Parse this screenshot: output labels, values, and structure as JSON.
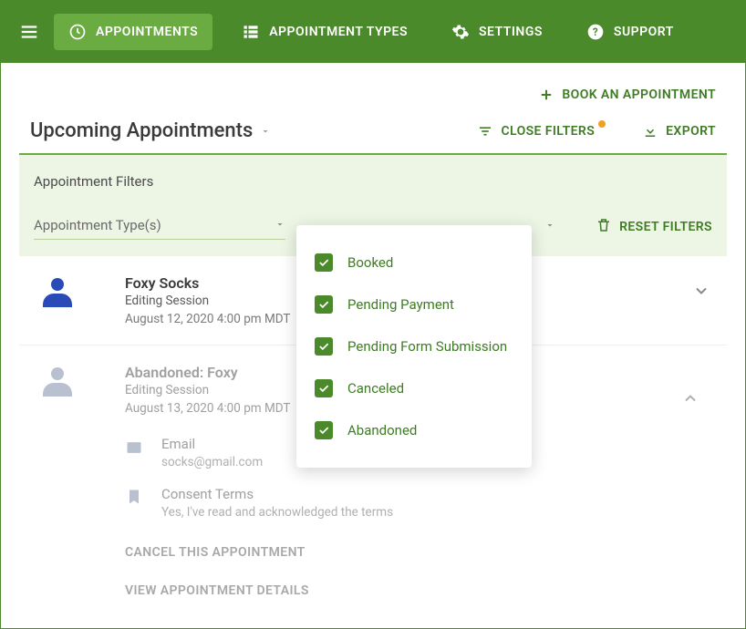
{
  "nav": {
    "appointments": "APPOINTMENTS",
    "appointment_types": "APPOINTMENT TYPES",
    "settings": "SETTINGS",
    "support": "SUPPORT"
  },
  "actions": {
    "book": "BOOK AN APPOINTMENT",
    "close_filters": "CLOSE FILTERS",
    "export": "EXPORT"
  },
  "page_title": "Upcoming Appointments",
  "filters": {
    "title": "Appointment Filters",
    "type_label": "Appointment Type(s)",
    "reset": "RESET FILTERS"
  },
  "status_options": [
    {
      "label": "Booked",
      "checked": true
    },
    {
      "label": "Pending Payment",
      "checked": true
    },
    {
      "label": "Pending Form Submission",
      "checked": true
    },
    {
      "label": "Canceled",
      "checked": true
    },
    {
      "label": "Abandoned",
      "checked": true
    }
  ],
  "appointments": [
    {
      "name": "Foxy Socks",
      "type": "Editing Session",
      "when": "August 12, 2020 4:00 pm MDT",
      "faded": false,
      "expanded": false
    },
    {
      "name": "Abandoned: Foxy",
      "type": "Editing Session",
      "when": "August 13, 2020 4:00 pm MDT",
      "faded": true,
      "expanded": true,
      "details": {
        "email": {
          "label": "Email",
          "value": "socks@gmail.com"
        },
        "consent": {
          "label": "Consent Terms",
          "value": "Yes, I've read and acknowledged the terms"
        }
      },
      "actions": {
        "cancel": "CANCEL THIS APPOINTMENT",
        "view": "VIEW APPOINTMENT DETAILS"
      }
    }
  ]
}
